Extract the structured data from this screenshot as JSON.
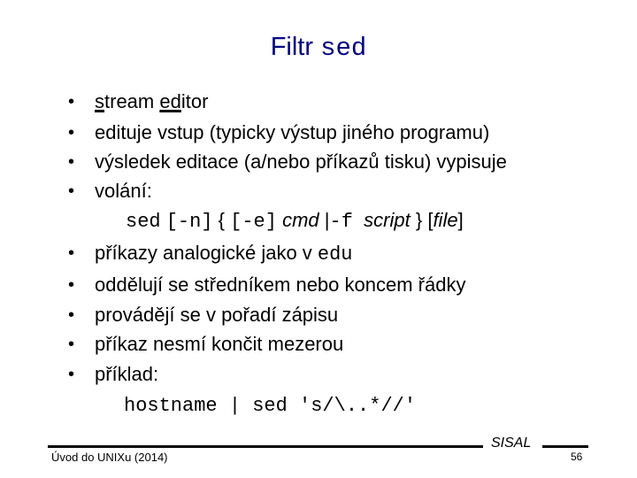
{
  "slide": {
    "title_prefix": "Filtr ",
    "title_code": "sed",
    "bullets": [
      {
        "parts": {
          "u1": "s",
          "t1": "tream ",
          "u2": "ed",
          "t2": "itor"
        }
      },
      {
        "text": "edituje vstup (typicky výstup jiného programu)"
      },
      {
        "text": "výsledek editace (a/nebo příkazů tisku) vypisuje"
      },
      {
        "text": "volání:"
      },
      {
        "text_prefix": "příkazy analogické jako v ",
        "text_code": "edu"
      },
      {
        "text": "oddělují se středníkem nebo koncem řádky"
      },
      {
        "text": "provádějí se v pořadí zápisu"
      },
      {
        "text": "příkaz nesmí končit mezerou"
      },
      {
        "text": "příklad:"
      }
    ],
    "bullet_glyph": "•",
    "syntax": {
      "cmd": "sed",
      "opt_n": "[-n]",
      "brace_open": "{",
      "opt_e": "[-e]",
      "arg_cmd": "cmd",
      "pipe": "|",
      "opt_f": "-f",
      "arg_script": "script",
      "brace_close": "}",
      "arg_file_open": "[",
      "arg_file": "file",
      "arg_file_close": "]"
    },
    "example": "hostname | sed 's/\\..*//'"
  },
  "footer": {
    "left": "Úvod do UNIXu (2014)",
    "center": "SISAL",
    "page": "56"
  },
  "colors": {
    "title": "#000080",
    "text": "#000000"
  }
}
